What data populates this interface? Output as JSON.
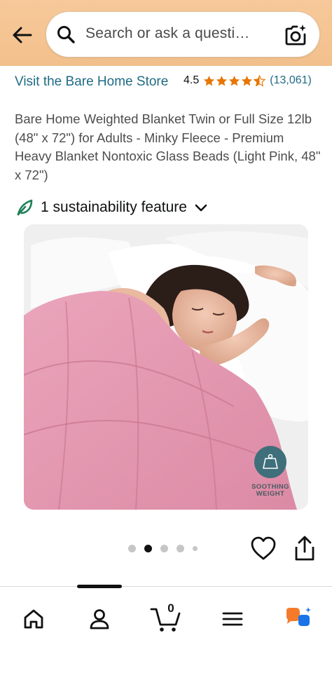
{
  "search": {
    "placeholder": "Search or ask a questi…"
  },
  "product": {
    "store_link": "Visit the Bare Home Store",
    "rating_value": "4.5",
    "rating_stars": 4.5,
    "rating_count": "(13,061)",
    "title": "Bare Home Weighted Blanket Twin or Full Size 12lb (48\" x 72\") for Adults - Minky Fleece - Premium Heavy Blanket Nontoxic Glass Beads (Light Pink, 48\" x 72\")",
    "sustainability": "1 sustainability feature",
    "image_badge": {
      "icon_text": "LBS",
      "line1": "SOOTHING",
      "line2": "WEIGHT"
    }
  },
  "carousel": {
    "total_images": 5,
    "active_index": 1
  },
  "bottom_nav": {
    "cart_count": "0"
  },
  "colors": {
    "header_bg": "#f2c08c",
    "link": "#1f6b84",
    "star": "#e77600",
    "sustain_leaf": "#1e7f57",
    "badge": "#3f6f7a",
    "blanket_pink": "#e79bb4"
  }
}
